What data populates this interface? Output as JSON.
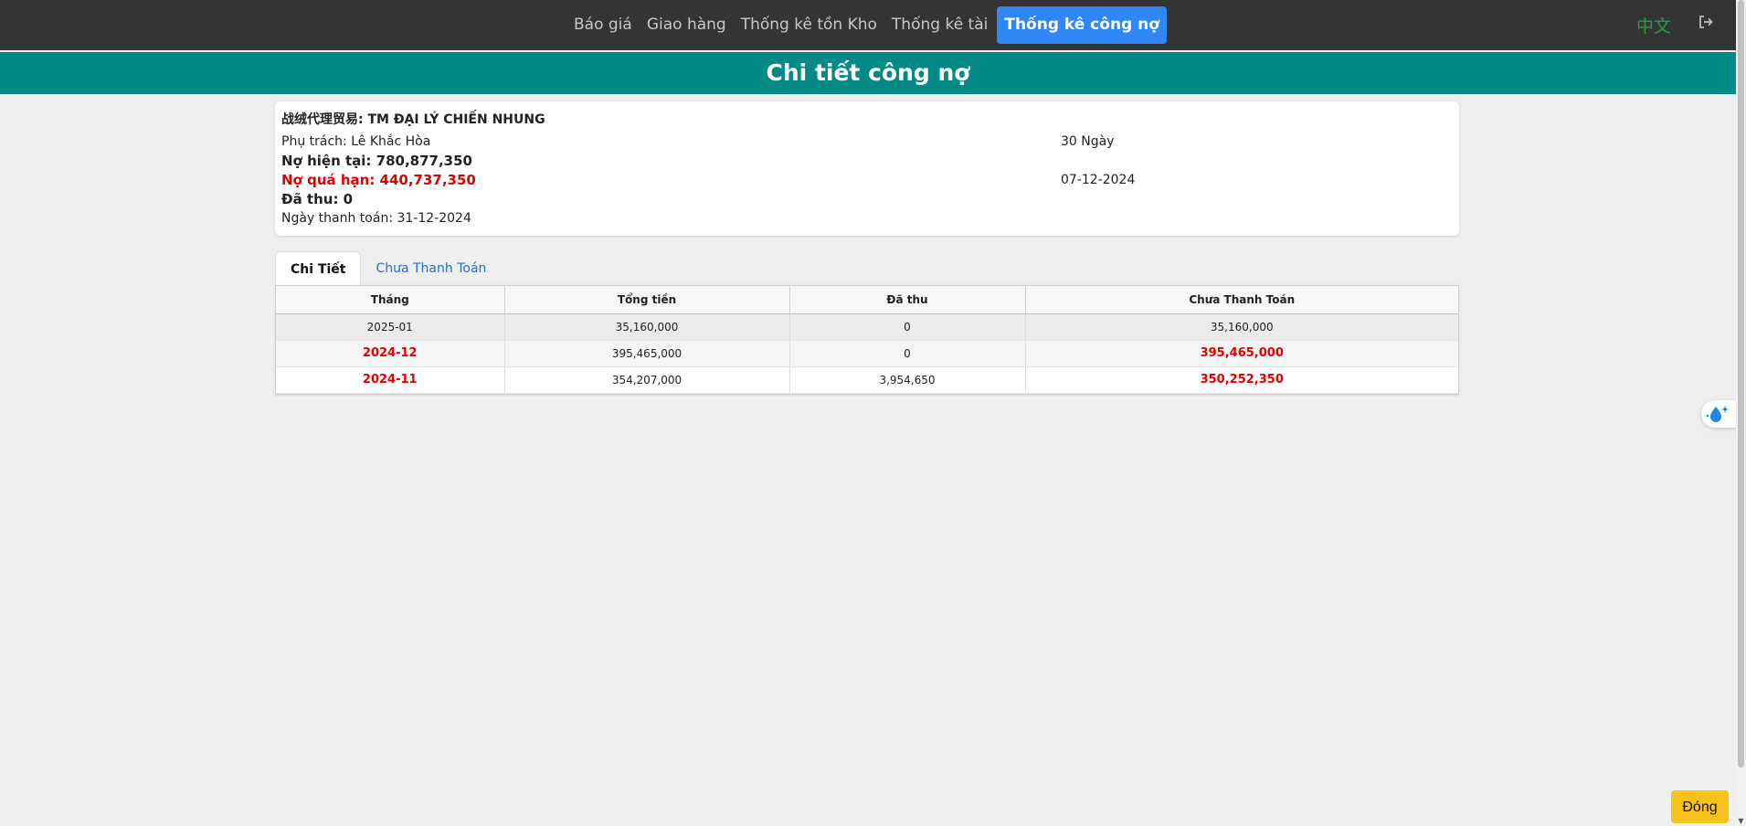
{
  "nav": {
    "links": [
      "Báo giá",
      "Giao hàng",
      "Thống kê tồn Kho",
      "Thống kê tài",
      "Thống kê công nợ"
    ],
    "active_index": 4,
    "lang_label": "中文",
    "lang_color": "#27a046",
    "logout_icon": "logout-icon"
  },
  "header": {
    "title": "Chi tiết công nợ",
    "band_color": "#048a86"
  },
  "info": {
    "customer": "战绒代理贸易: TM ĐẠI LÝ CHIẾN NHUNG",
    "handler": "Phụ trách: Lê Khắc Hòa",
    "current_debt": "Nợ hiện tại: 780,877,350",
    "overdue_debt": "Nợ quá hạn: 440,737,350",
    "collected": "Đã thu: 0",
    "payment_date": "Ngày thanh toán: 31-12-2024",
    "term": "30 Ngày",
    "overdue_date": "07-12-2024"
  },
  "tabs": [
    {
      "label": "Chi Tiết",
      "active": true
    },
    {
      "label": "Chưa Thanh Toán",
      "active": false
    }
  ],
  "table": {
    "headers": [
      "Tháng",
      "Tổng tiền",
      "Đã thu",
      "Chưa Thanh Toán"
    ],
    "rows": [
      {
        "month": "2025-01",
        "total": "35,160,000",
        "collected": "0",
        "unpaid": "35,160,000",
        "overdue": false
      },
      {
        "month": "2024-12",
        "total": "395,465,000",
        "collected": "0",
        "unpaid": "395,465,000",
        "overdue": true
      },
      {
        "month": "2024-11",
        "total": "354,207,000",
        "collected": "3,954,650",
        "unpaid": "350,252,350",
        "overdue": true
      }
    ]
  },
  "colors": {
    "accent_blue": "#2f86f6",
    "overdue_red": "#e00000",
    "close_yellow": "#f7c21a"
  },
  "close_button": {
    "label": "Đóng"
  },
  "floating_widget_icon": "water-drop-sparkle-icon"
}
